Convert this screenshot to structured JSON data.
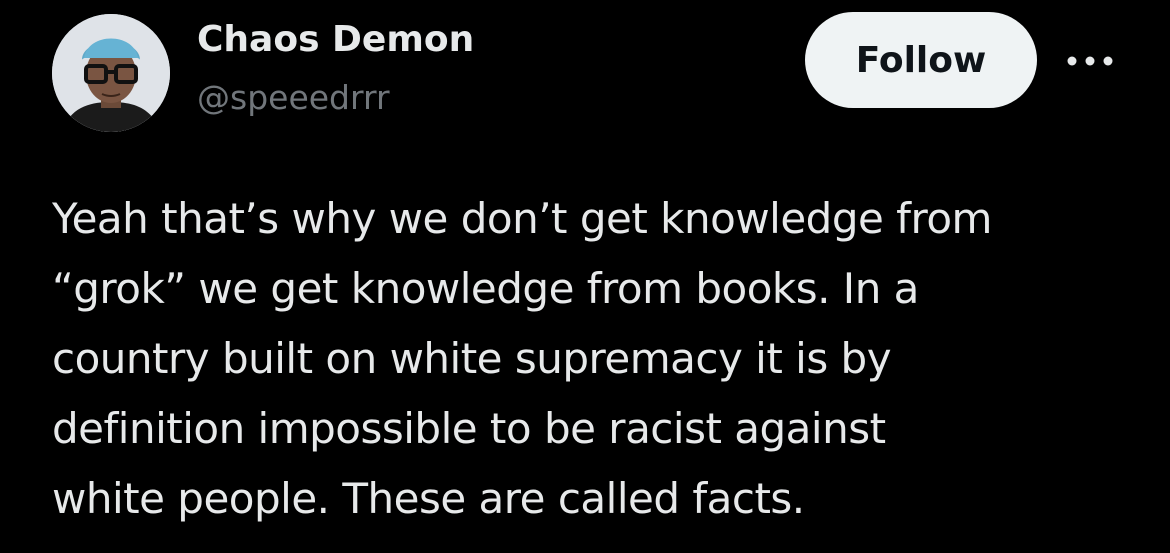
{
  "author": {
    "display_name": "Chaos Demon",
    "handle": "@speeedrrr",
    "avatar_icon": "person-avatar-icon"
  },
  "actions": {
    "follow_label": "Follow",
    "more_icon": "more-horizontal-icon"
  },
  "tweet": {
    "text": "Yeah that’s why we don’t get knowledge from\n“grok” we get knowledge from books. In a\ncountry built on white supremacy it is by\ndefinition impossible to be racist against\nwhite people. These are called facts."
  },
  "colors": {
    "background": "#000000",
    "primary_text": "#e7e9ea",
    "secondary_text": "#71767b",
    "follow_bg": "#eff3f4",
    "follow_text": "#0f1419"
  }
}
